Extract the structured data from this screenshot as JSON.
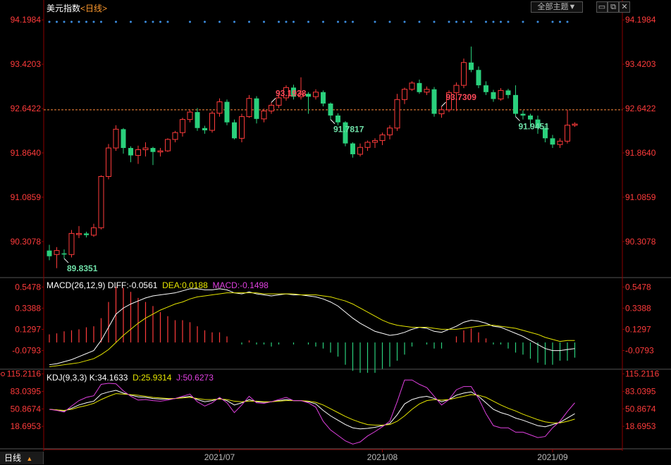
{
  "title": {
    "name": "美元指数",
    "period": "<日线>"
  },
  "toolbar": {
    "theme_label": "全部主题▼",
    "min": "▭",
    "max": "⧉",
    "close": "✕"
  },
  "period_tab": {
    "label": "日线",
    "arrow": "▲"
  },
  "colors": {
    "up": "#ff3b3b",
    "down": "#2ad07c",
    "grid": "#8b0000",
    "axis_text": "#ff3b3b",
    "dif": "#ffffff",
    "dea": "#e6e600",
    "k": "#ffffff",
    "d": "#e6e600",
    "j": "#e040e0",
    "dots": "#3c8de0",
    "ref": "#ff8c3c"
  },
  "main_axis": {
    "ticks": [
      "94.1984",
      "93.4203",
      "92.6422",
      "91.8640",
      "91.0859",
      "90.3078"
    ],
    "tick_values": [
      94.1984,
      93.4203,
      92.6422,
      91.864,
      91.0859,
      90.3078
    ],
    "ylim": [
      89.7,
      94.3
    ]
  },
  "macd_axis": {
    "ticks": [
      "0.5478",
      "0.3388",
      "0.1297",
      "-0.0793"
    ],
    "tick_values": [
      0.5478,
      0.3388,
      0.1297,
      -0.0793
    ],
    "ylim": [
      -0.25,
      0.62
    ]
  },
  "kdj_axis": {
    "ticks": [
      "115.2116",
      "83.0395",
      "50.8674",
      "18.6953"
    ],
    "tick_values": [
      115.2116,
      83.0395,
      50.8674,
      18.6953
    ],
    "ylim": [
      -20,
      120
    ]
  },
  "x_labels": [
    {
      "label": "2021/07",
      "index": 23
    },
    {
      "label": "2021/08",
      "index": 45
    },
    {
      "label": "2021/09",
      "index": 68
    }
  ],
  "macd_header": {
    "name": "MACD(26,12,9)",
    "dif": "DIFF:-0.0561",
    "dea": "DEA:0.0188",
    "macd": "MACD:-0.1498"
  },
  "kdj_header": {
    "name": "KDJ(9,3,3)",
    "k": "K:34.1633",
    "d": "D:25.9314",
    "j": "J:50.6273"
  },
  "chart_data": {
    "type": "candlestick",
    "title": "美元指数 <日线>",
    "ref_price": 92.62,
    "annotations": [
      {
        "label": "89.8351",
        "index": 2,
        "kind": "low"
      },
      {
        "label": "93.1938",
        "index": 30,
        "kind": "high"
      },
      {
        "label": "91.7817",
        "index": 38,
        "kind": "low"
      },
      {
        "label": "93.7309",
        "index": 53,
        "kind": "high"
      },
      {
        "label": "91.9451",
        "index": 63,
        "kind": "low"
      }
    ],
    "candles": [
      [
        90.15,
        90.05,
        90.25,
        89.98
      ],
      [
        90.08,
        90.15,
        90.21,
        89.84
      ],
      [
        90.1,
        90.08,
        90.17,
        90.01
      ],
      [
        90.08,
        90.45,
        90.51,
        90.03
      ],
      [
        90.43,
        90.45,
        90.58,
        90.37
      ],
      [
        90.45,
        90.42,
        90.48,
        90.38
      ],
      [
        90.42,
        90.55,
        90.62,
        90.39
      ],
      [
        90.55,
        91.45,
        91.47,
        90.52
      ],
      [
        91.45,
        91.95,
        92.02,
        91.4
      ],
      [
        91.95,
        92.28,
        92.35,
        91.9
      ],
      [
        92.28,
        91.95,
        92.3,
        91.85
      ],
      [
        91.95,
        91.82,
        91.98,
        91.7
      ],
      [
        91.82,
        91.92,
        91.99,
        91.67
      ],
      [
        91.92,
        91.95,
        92.05,
        91.8
      ],
      [
        91.95,
        91.88,
        91.97,
        91.65
      ],
      [
        91.88,
        91.9,
        91.95,
        91.8
      ],
      [
        91.9,
        92.1,
        92.12,
        91.88
      ],
      [
        92.1,
        92.22,
        92.25,
        92.05
      ],
      [
        92.22,
        92.45,
        92.48,
        92.15
      ],
      [
        92.45,
        92.58,
        92.62,
        92.4
      ],
      [
        92.58,
        92.3,
        92.65,
        92.25
      ],
      [
        92.3,
        92.26,
        92.34,
        92.2
      ],
      [
        92.26,
        92.56,
        92.6,
        92.22
      ],
      [
        92.56,
        92.76,
        92.82,
        92.5
      ],
      [
        92.76,
        92.4,
        92.8,
        92.35
      ],
      [
        92.4,
        92.12,
        92.45,
        92.1
      ],
      [
        92.12,
        92.5,
        92.55,
        92.05
      ],
      [
        92.5,
        92.82,
        92.88,
        92.48
      ],
      [
        92.82,
        92.46,
        92.86,
        92.38
      ],
      [
        92.46,
        92.6,
        92.64,
        92.4
      ],
      [
        92.6,
        92.7,
        92.75,
        92.55
      ],
      [
        92.7,
        92.83,
        92.9,
        92.65
      ],
      [
        92.83,
        93.01,
        93.05,
        92.78
      ],
      [
        93.01,
        92.85,
        93.06,
        92.8
      ],
      [
        92.85,
        92.9,
        93.19,
        92.8
      ],
      [
        92.9,
        92.85,
        92.93,
        92.55
      ],
      [
        92.85,
        92.93,
        92.98,
        92.8
      ],
      [
        92.93,
        92.73,
        92.96,
        92.68
      ],
      [
        92.73,
        92.52,
        92.75,
        92.45
      ],
      [
        92.52,
        92.4,
        92.56,
        92.35
      ],
      [
        92.4,
        92.03,
        92.42,
        91.98
      ],
      [
        92.03,
        91.84,
        92.05,
        91.78
      ],
      [
        91.84,
        91.96,
        92.03,
        91.8
      ],
      [
        91.96,
        92.05,
        92.08,
        91.9
      ],
      [
        92.05,
        92.08,
        92.12,
        91.95
      ],
      [
        92.08,
        92.18,
        92.22,
        92.0
      ],
      [
        92.18,
        92.3,
        92.35,
        92.1
      ],
      [
        92.3,
        92.8,
        92.9,
        92.25
      ],
      [
        92.8,
        92.98,
        93.01,
        92.72
      ],
      [
        92.98,
        93.09,
        93.12,
        92.95
      ],
      [
        93.09,
        92.93,
        93.15,
        92.9
      ],
      [
        92.93,
        92.98,
        93.03,
        92.88
      ],
      [
        92.98,
        92.55,
        93.02,
        92.5
      ],
      [
        92.55,
        92.62,
        92.68,
        92.48
      ],
      [
        92.62,
        92.92,
        92.96,
        92.58
      ],
      [
        92.92,
        93.05,
        93.1,
        92.6
      ],
      [
        93.05,
        93.45,
        93.52,
        93.0
      ],
      [
        93.45,
        93.32,
        93.73,
        93.28
      ],
      [
        93.32,
        93.05,
        93.38,
        93.0
      ],
      [
        93.05,
        92.93,
        93.12,
        92.88
      ],
      [
        92.93,
        92.81,
        92.97,
        92.76
      ],
      [
        92.81,
        92.96,
        93.0,
        92.78
      ],
      [
        92.96,
        92.88,
        92.99,
        92.82
      ],
      [
        92.88,
        92.55,
        93.05,
        92.5
      ],
      [
        92.55,
        92.52,
        92.61,
        92.45
      ],
      [
        92.52,
        92.45,
        92.55,
        92.3
      ],
      [
        92.45,
        92.3,
        92.52,
        92.2
      ],
      [
        92.3,
        92.12,
        92.34,
        92.05
      ],
      [
        92.12,
        92.01,
        92.18,
        91.95
      ],
      [
        92.01,
        92.07,
        92.12,
        91.95
      ],
      [
        92.07,
        92.35,
        92.62,
        92.03
      ],
      [
        92.35,
        92.37,
        92.4,
        92.32
      ]
    ],
    "dots_on": [
      0,
      1,
      2,
      3,
      4,
      5,
      6,
      7,
      9,
      11,
      13,
      14,
      15,
      16,
      19,
      21,
      23,
      25,
      27,
      29,
      31,
      32,
      33,
      35,
      37,
      39,
      40,
      41,
      44,
      46,
      48,
      50,
      52,
      54,
      55,
      56,
      57,
      59,
      60,
      61,
      62,
      64,
      66,
      68,
      69,
      70
    ],
    "macd": {
      "dif": [
        -0.22,
        -0.21,
        -0.19,
        -0.17,
        -0.14,
        -0.11,
        -0.08,
        0.02,
        0.15,
        0.28,
        0.34,
        0.38,
        0.41,
        0.44,
        0.46,
        0.47,
        0.48,
        0.49,
        0.51,
        0.53,
        0.53,
        0.52,
        0.52,
        0.53,
        0.52,
        0.49,
        0.48,
        0.5,
        0.48,
        0.47,
        0.46,
        0.47,
        0.48,
        0.47,
        0.47,
        0.46,
        0.45,
        0.43,
        0.4,
        0.36,
        0.3,
        0.24,
        0.19,
        0.15,
        0.11,
        0.09,
        0.07,
        0.08,
        0.1,
        0.13,
        0.15,
        0.14,
        0.11,
        0.1,
        0.13,
        0.16,
        0.2,
        0.22,
        0.21,
        0.19,
        0.16,
        0.15,
        0.12,
        0.09,
        0.06,
        0.02,
        -0.02,
        -0.06,
        -0.08,
        -0.08,
        -0.07,
        -0.06
      ],
      "dea": [
        -0.24,
        -0.23,
        -0.22,
        -0.21,
        -0.2,
        -0.18,
        -0.16,
        -0.12,
        -0.07,
        0.0,
        0.07,
        0.13,
        0.19,
        0.24,
        0.28,
        0.32,
        0.35,
        0.38,
        0.4,
        0.43,
        0.45,
        0.46,
        0.47,
        0.48,
        0.49,
        0.49,
        0.49,
        0.49,
        0.49,
        0.48,
        0.48,
        0.48,
        0.48,
        0.48,
        0.47,
        0.47,
        0.47,
        0.46,
        0.45,
        0.43,
        0.41,
        0.38,
        0.34,
        0.3,
        0.26,
        0.22,
        0.19,
        0.17,
        0.16,
        0.15,
        0.15,
        0.15,
        0.14,
        0.13,
        0.13,
        0.13,
        0.14,
        0.15,
        0.16,
        0.17,
        0.17,
        0.16,
        0.15,
        0.14,
        0.12,
        0.1,
        0.08,
        0.05,
        0.03,
        0.01,
        0.02,
        0.02
      ],
      "hist": [
        0.08,
        0.09,
        0.11,
        0.12,
        0.13,
        0.15,
        0.16,
        0.24,
        0.4,
        0.55,
        0.54,
        0.5,
        0.44,
        0.4,
        0.36,
        0.3,
        0.26,
        0.22,
        0.22,
        0.2,
        0.16,
        0.12,
        0.1,
        0.1,
        0.06,
        0.0,
        -0.02,
        0.02,
        -0.02,
        -0.02,
        -0.04,
        -0.02,
        0.0,
        -0.02,
        0.0,
        -0.02,
        -0.04,
        -0.06,
        -0.1,
        -0.14,
        -0.22,
        -0.28,
        -0.3,
        -0.3,
        -0.3,
        -0.26,
        -0.24,
        -0.18,
        -0.12,
        -0.04,
        0.0,
        -0.02,
        -0.06,
        -0.06,
        0.0,
        0.06,
        0.12,
        0.14,
        0.1,
        0.04,
        -0.02,
        -0.02,
        -0.06,
        -0.1,
        -0.12,
        -0.16,
        -0.2,
        -0.22,
        -0.22,
        -0.18,
        -0.18,
        -0.15
      ]
    },
    "kdj": {
      "k": [
        50,
        49,
        47,
        52,
        58,
        62,
        65,
        78,
        82,
        85,
        80,
        76,
        73,
        72,
        70,
        69,
        69,
        70,
        72,
        74,
        68,
        64,
        66,
        70,
        66,
        58,
        62,
        68,
        64,
        63,
        64,
        66,
        68,
        66,
        66,
        64,
        60,
        48,
        38,
        30,
        22,
        16,
        14,
        15,
        17,
        20,
        24,
        40,
        60,
        68,
        72,
        74,
        70,
        64,
        68,
        76,
        80,
        82,
        74,
        62,
        50,
        44,
        40,
        34,
        30,
        25,
        20,
        18,
        22,
        26,
        34,
        42
      ],
      "d": [
        50,
        49,
        48,
        50,
        54,
        57,
        61,
        68,
        74,
        79,
        78,
        77,
        76,
        74,
        72,
        71,
        70,
        70,
        71,
        72,
        70,
        68,
        68,
        69,
        68,
        65,
        64,
        65,
        65,
        64,
        64,
        65,
        66,
        66,
        66,
        65,
        63,
        58,
        51,
        44,
        37,
        31,
        26,
        22,
        21,
        21,
        22,
        28,
        38,
        50,
        60,
        66,
        68,
        67,
        68,
        71,
        74,
        77,
        76,
        72,
        65,
        58,
        52,
        47,
        41,
        36,
        31,
        27,
        25,
        25,
        28,
        32
      ],
      "j": [
        50,
        48,
        45,
        56,
        66,
        72,
        75,
        96,
        98,
        97,
        84,
        74,
        67,
        68,
        66,
        65,
        67,
        70,
        74,
        78,
        64,
        56,
        62,
        72,
        62,
        44,
        58,
        74,
        62,
        61,
        64,
        68,
        72,
        66,
        66,
        62,
        54,
        28,
        12,
        2,
        -8,
        -14,
        -10,
        1,
        9,
        18,
        28,
        64,
        104,
        104,
        96,
        90,
        74,
        58,
        68,
        86,
        92,
        92,
        70,
        42,
        20,
        16,
        16,
        8,
        8,
        3,
        -2,
        0,
        16,
        28,
        46,
        62
      ]
    }
  }
}
